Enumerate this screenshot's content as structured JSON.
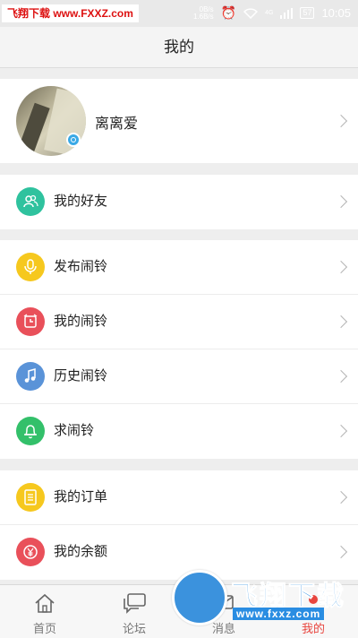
{
  "status_bar": {
    "watermark": "飞翔下载 www.FXXZ.com",
    "net_speed_1": "0B/s",
    "net_speed_2": "1.6B/s",
    "signal_label": "4G",
    "battery": "57",
    "time": "10:05"
  },
  "header": {
    "title": "我的"
  },
  "profile": {
    "username": "离离爱"
  },
  "groups": [
    {
      "items": [
        {
          "label": "我的好友",
          "icon": "friends-icon",
          "color": "#2fc29e"
        }
      ]
    },
    {
      "items": [
        {
          "label": "发布闹铃",
          "icon": "microphone-icon",
          "color": "#f6c81e"
        },
        {
          "label": "我的闹铃",
          "icon": "alarm-clock-icon",
          "color": "#e9505a"
        },
        {
          "label": "历史闹铃",
          "icon": "music-note-icon",
          "color": "#5a93d8"
        },
        {
          "label": "求闹铃",
          "icon": "bell-icon",
          "color": "#33c06a"
        }
      ]
    },
    {
      "items": [
        {
          "label": "我的订单",
          "icon": "order-list-icon",
          "color": "#f6c81e"
        },
        {
          "label": "我的余额",
          "icon": "yuan-coin-icon",
          "color": "#e9505a"
        }
      ]
    }
  ],
  "tabbar": {
    "tabs": [
      {
        "label": "首页",
        "icon": "home-icon"
      },
      {
        "label": "论坛",
        "icon": "forum-icon"
      },
      {
        "label": "消息",
        "icon": "message-icon"
      },
      {
        "label": "我的",
        "icon": "profile-icon",
        "active": true
      }
    ],
    "active_color": "#e8463f"
  },
  "site_logo": {
    "text": "飞翔下载",
    "url": "www.fxxz.com"
  }
}
